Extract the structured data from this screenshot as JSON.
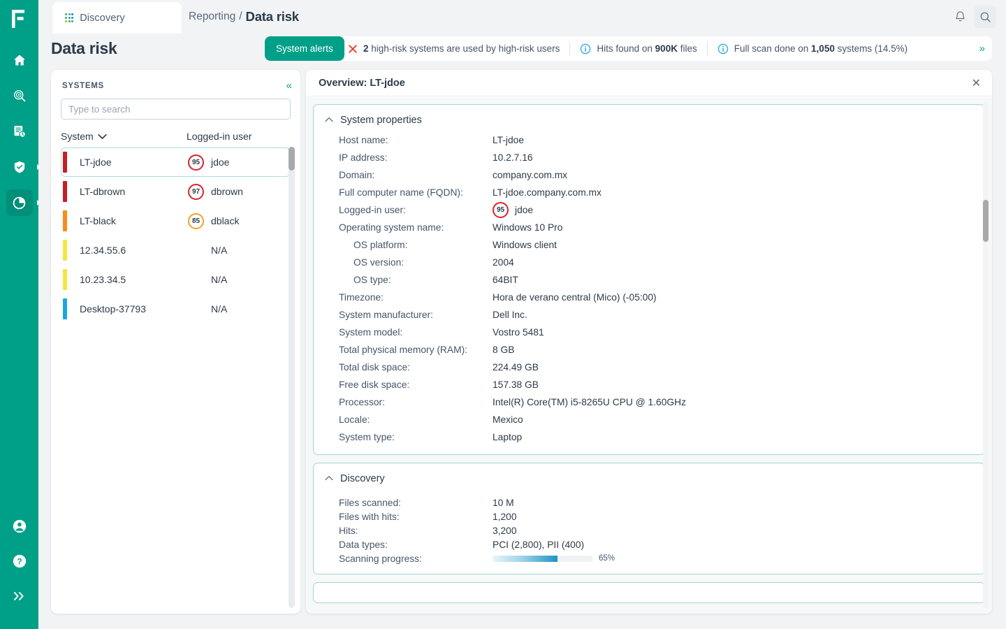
{
  "rail": {
    "logo": "brand-logo-f",
    "items": [
      {
        "name": "home",
        "icon": "home-icon",
        "active": false,
        "submenu": false
      },
      {
        "name": "discover",
        "icon": "search-target-icon",
        "active": false,
        "submenu": false
      },
      {
        "name": "reports",
        "icon": "document-clock-icon",
        "active": false,
        "submenu": false
      },
      {
        "name": "protection",
        "icon": "shield-check-icon",
        "active": false,
        "submenu": true
      },
      {
        "name": "reporting",
        "icon": "pie-chart-icon",
        "active": true,
        "submenu": true
      }
    ],
    "bottom_items": [
      {
        "name": "account",
        "icon": "user-circle-icon"
      },
      {
        "name": "help",
        "icon": "question-circle-icon"
      },
      {
        "name": "expand-rail",
        "icon": "chevron-double-right-icon"
      }
    ]
  },
  "topbar": {
    "app_tab_label": "Discovery",
    "app_tab_icon": "dot-grid-icon",
    "breadcrumb_parent": "Reporting",
    "breadcrumb_separator": "/",
    "breadcrumb_current": "Data risk",
    "notifications_icon": "bell-icon",
    "search_icon": "search-icon"
  },
  "page": {
    "title": "Data risk",
    "alerts_button": "System alerts",
    "alerts": [
      {
        "icon": "error-x-icon",
        "prefix": "",
        "value": "2",
        "suffix": " high-risk systems are used by high-risk users"
      },
      {
        "icon": "info-circle-icon",
        "prefix": "Hits found on ",
        "value": "900K",
        "suffix": " files"
      },
      {
        "icon": "info-circle-icon",
        "prefix": "Full scan done on ",
        "value": "1,050",
        "suffix": " systems (14.5%)"
      }
    ],
    "alerts_more_icon": "chevron-double-right-icon"
  },
  "systems": {
    "title": "SYSTEMS",
    "collapse_icon": "chevron-double-left-icon",
    "search_placeholder": "Type to search",
    "search_value": "",
    "columns": {
      "system": "System",
      "user": "Logged-in user"
    },
    "sort_icon": "chevron-down-icon",
    "rows": [
      {
        "name": "LT-jdoe",
        "risk_color": "#c32025",
        "score": "95",
        "score_color": "#d8232a",
        "user": "jdoe",
        "selected": true
      },
      {
        "name": "LT-dbrown",
        "risk_color": "#c32025",
        "score": "97",
        "score_color": "#d8232a",
        "user": "dbrown",
        "selected": false
      },
      {
        "name": "LT-black",
        "risk_color": "#f98b19",
        "score": "85",
        "score_color": "#f2a02a",
        "user": "dblack",
        "selected": false
      },
      {
        "name": "12.34.55.6",
        "risk_color": "#f5e541",
        "score": "",
        "score_color": "",
        "user": "N/A",
        "selected": false
      },
      {
        "name": "10.23.34.5",
        "risk_color": "#f5e541",
        "score": "",
        "score_color": "",
        "user": "N/A",
        "selected": false
      },
      {
        "name": "Desktop-37793",
        "risk_color": "#1aa7e0",
        "score": "",
        "score_color": "",
        "user": "N/A",
        "selected": false
      }
    ]
  },
  "detail": {
    "title": "Overview: LT-jdoe",
    "close_icon": "close-icon",
    "collapse_icon": "chevron-up-icon",
    "system_properties": {
      "heading": "System properties",
      "rows": [
        {
          "label": "Host name:",
          "value": "LT-jdoe",
          "indent": false,
          "badge": ""
        },
        {
          "label": "IP address:",
          "value": "10.2.7.16",
          "indent": false,
          "badge": ""
        },
        {
          "label": "Domain:",
          "value": "company.com.mx",
          "indent": false,
          "badge": ""
        },
        {
          "label": "Full computer name (FQDN):",
          "value": "LT-jdoe.company.com.mx",
          "indent": false,
          "badge": ""
        },
        {
          "label": "Logged-in user:",
          "value": "jdoe",
          "indent": false,
          "badge": "95"
        },
        {
          "label": "Operating system name:",
          "value": "Windows 10 Pro",
          "indent": false,
          "badge": ""
        },
        {
          "label": "OS platform:",
          "value": "Windows client",
          "indent": true,
          "badge": ""
        },
        {
          "label": "OS version:",
          "value": "2004",
          "indent": true,
          "badge": ""
        },
        {
          "label": "OS type:",
          "value": "64BIT",
          "indent": true,
          "badge": ""
        },
        {
          "label": "Timezone:",
          "value": "Hora de verano central (Mico) (-05:00)",
          "indent": false,
          "badge": ""
        },
        {
          "label": "System manufacturer:",
          "value": "Dell Inc.",
          "indent": false,
          "badge": ""
        },
        {
          "label": "System model:",
          "value": "Vostro 5481",
          "indent": false,
          "badge": ""
        },
        {
          "label": "Total physical memory (RAM):",
          "value": "8 GB",
          "indent": false,
          "badge": ""
        },
        {
          "label": "Total disk space:",
          "value": "224.49 GB",
          "indent": false,
          "badge": ""
        },
        {
          "label": "Free disk space:",
          "value": "157.38 GB",
          "indent": false,
          "badge": ""
        },
        {
          "label": "Processor:",
          "value": "Intel(R) Core(TM) i5-8265U CPU @ 1.60GHz",
          "indent": false,
          "badge": ""
        },
        {
          "label": "Locale:",
          "value": "Mexico",
          "indent": false,
          "badge": ""
        },
        {
          "label": "System type:",
          "value": "Laptop",
          "indent": false,
          "badge": ""
        }
      ]
    },
    "discovery": {
      "heading": "Discovery",
      "rows": [
        {
          "label": "Files scanned:",
          "value": "10 M"
        },
        {
          "label": "Files with hits:",
          "value": "1,200"
        },
        {
          "label": "Hits:",
          "value": "3,200"
        },
        {
          "label": "Data types:",
          "value": "PCI (2,800), PII (400)"
        }
      ],
      "progress_label": "Scanning progress:",
      "progress_percent": "65%",
      "progress_value": 65
    }
  }
}
